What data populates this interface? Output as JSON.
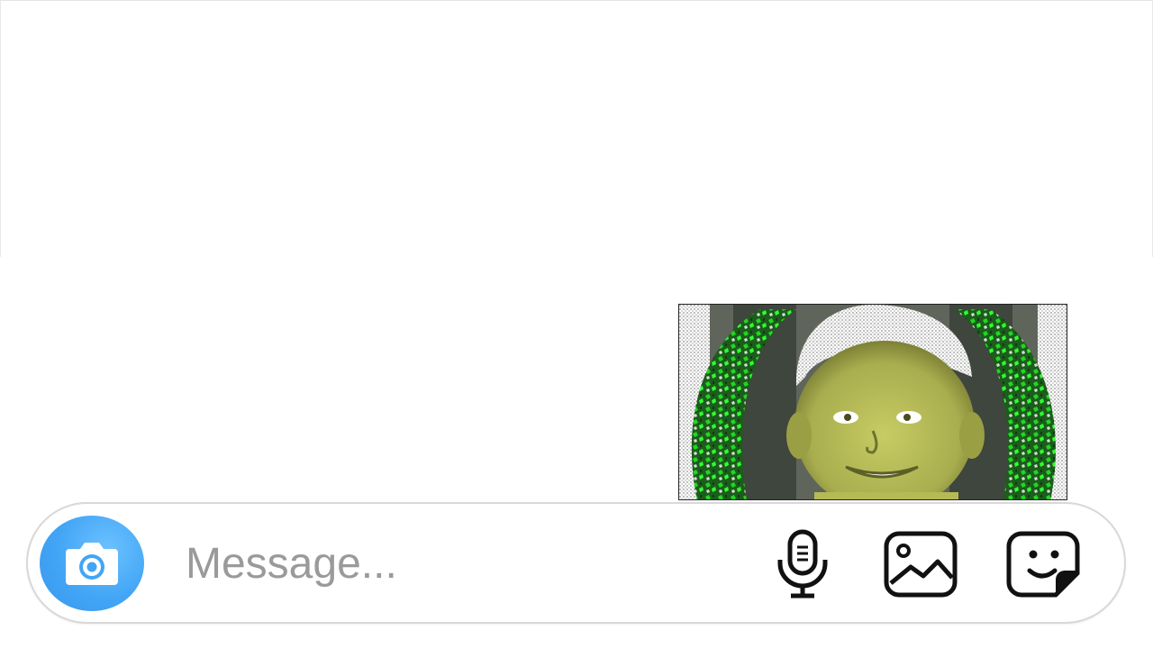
{
  "composer": {
    "placeholder": "Message...",
    "value": "",
    "camera_icon": "camera-icon",
    "mic_icon": "microphone-icon",
    "gallery_icon": "gallery-icon",
    "sticker_icon": "sticker-icon"
  },
  "thread": {
    "messages": [
      {
        "type": "photo",
        "alignment": "right",
        "description_icon": "photo"
      }
    ]
  },
  "colors": {
    "camera_button": "#42a5f5",
    "placeholder": "#9a9a9a",
    "composer_border": "#d8d8d8"
  }
}
